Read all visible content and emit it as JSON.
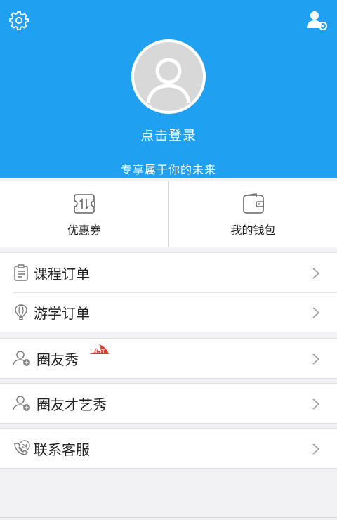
{
  "header": {
    "login_label": "点击登录",
    "slogan": "专享属于你的未来",
    "background_color": "#20a0f0"
  },
  "quick_actions": [
    {
      "label": "优惠券",
      "icon": "coupon-icon"
    },
    {
      "label": "我的钱包",
      "icon": "wallet-icon"
    }
  ],
  "menu": {
    "course_orders": "课程订单",
    "study_tour_orders": "游学订单",
    "friends_show": "圈友秀",
    "friends_show_badge": "HOT",
    "friends_talent_show": "圈友才艺秀",
    "contact_service": "联系客服",
    "contact_icon_badge": "24"
  }
}
